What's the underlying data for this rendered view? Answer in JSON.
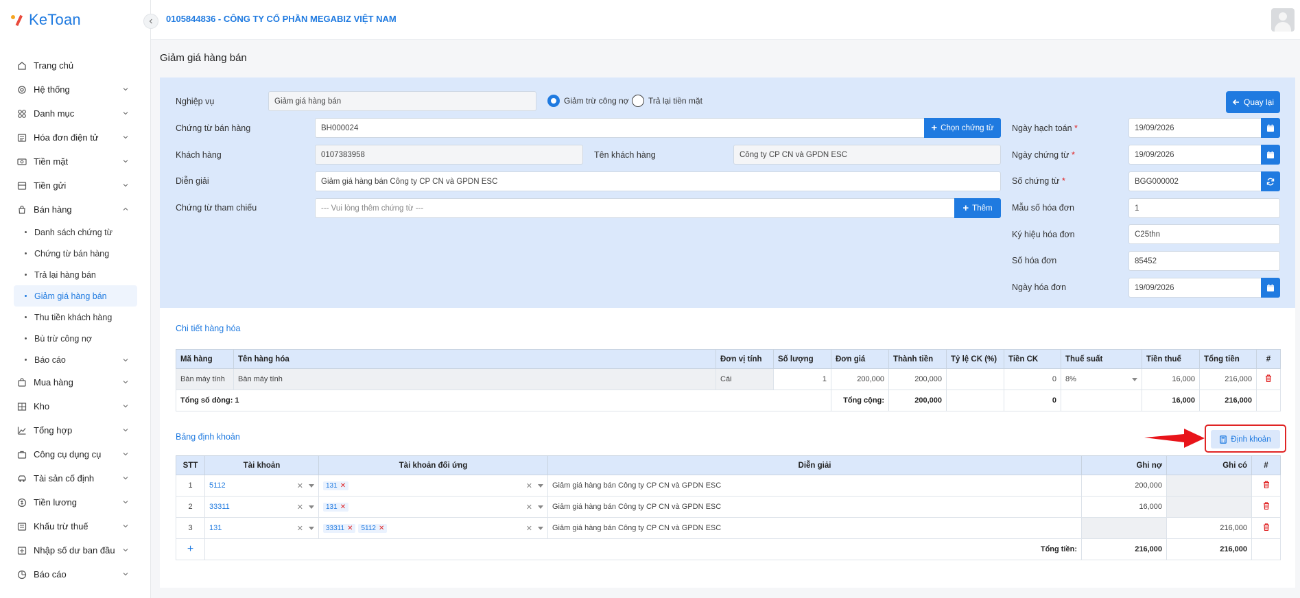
{
  "app": {
    "logo_text": "KeToan"
  },
  "header": {
    "company": "0105844836 - CÔNG TY CỔ PHẦN MEGABIZ VIỆT NAM"
  },
  "sidebar": {
    "items": [
      {
        "label": "Trang chủ",
        "icon": "home-icon"
      },
      {
        "label": "Hệ thống",
        "icon": "settings-icon"
      },
      {
        "label": "Danh mục",
        "icon": "grid-icon"
      },
      {
        "label": "Hóa đơn điện tử",
        "icon": "invoice-icon"
      },
      {
        "label": "Tiền mặt",
        "icon": "cash-icon"
      },
      {
        "label": "Tiền gửi",
        "icon": "bank-icon"
      },
      {
        "label": "Bán hàng",
        "icon": "cart-icon"
      }
    ],
    "sales_sub": [
      "Danh sách chứng từ",
      "Chứng từ bán hàng",
      "Trả lại hàng bán",
      "Giảm giá hàng bán",
      "Thu tiền khách hàng",
      "Bù trừ công nợ",
      "Báo cáo"
    ],
    "items_after": [
      {
        "label": "Mua hàng",
        "icon": "shopping-bag-icon"
      },
      {
        "label": "Kho",
        "icon": "warehouse-icon"
      },
      {
        "label": "Tổng hợp",
        "icon": "chart-icon"
      },
      {
        "label": "Công cụ dụng cụ",
        "icon": "tools-icon"
      },
      {
        "label": "Tài sản cố định",
        "icon": "car-icon"
      },
      {
        "label": "Tiền lương",
        "icon": "salary-icon"
      },
      {
        "label": "Khấu trừ thuế",
        "icon": "tax-icon"
      },
      {
        "label": "Nhập số dư ban đầu",
        "icon": "balance-icon"
      },
      {
        "label": "Báo cáo",
        "icon": "report-icon"
      }
    ]
  },
  "page": {
    "title": "Giảm giá hàng bán",
    "back_label": "Quay lại"
  },
  "form": {
    "nghiep_vu_label": "Nghiệp vụ",
    "nghiep_vu_value": "Giảm giá hàng bán",
    "radio_1": "Giảm trừ công nợ",
    "radio_2": "Trả lại tiền mặt",
    "chung_tu_ban_hang_label": "Chứng từ bán hàng",
    "chung_tu_ban_hang_value": "BH000024",
    "chon_chung_tu_label": "Chọn chứng từ",
    "khach_hang_label": "Khách hàng",
    "khach_hang_value": "0107383958",
    "ten_khach_hang_label": "Tên khách hàng",
    "ten_khach_hang_value": "Công ty CP CN và GPDN ESC",
    "dien_giai_label": "Diễn giải",
    "dien_giai_value": "Giảm giá hàng bán Công ty CP CN và GPDN ESC",
    "tham_chieu_label": "Chứng từ tham chiếu",
    "tham_chieu_placeholder": "--- Vui lòng thêm chứng từ ---",
    "them_label": "Thêm",
    "ngay_hach_toan_label": "Ngày hạch toán",
    "ngay_hach_toan_value": "19/09/2026",
    "ngay_chung_tu_label": "Ngày chứng từ",
    "ngay_chung_tu_value": "19/09/2026",
    "so_chung_tu_label": "Số chứng từ",
    "so_chung_tu_value": "BGG000002",
    "mau_so_label": "Mẫu số hóa đơn",
    "mau_so_value": "1",
    "ky_hieu_label": "Ký hiệu hóa đơn",
    "ky_hieu_value": "C25thn",
    "so_hoa_don_label": "Số hóa đơn",
    "so_hoa_don_value": "85452",
    "ngay_hoa_don_label": "Ngày hóa đơn",
    "ngay_hoa_don_value": "19/09/2026",
    "required_mark": "*"
  },
  "goods": {
    "title": "Chi tiết hàng hóa",
    "headers": [
      "Mã hàng",
      "Tên hàng hóa",
      "Đơn vị tính",
      "Số lượng",
      "Đơn giá",
      "Thành tiền",
      "Tỷ lệ CK (%)",
      "Tiền CK",
      "Thuế suất",
      "Tiền thuế",
      "Tổng tiền",
      "#"
    ],
    "row": {
      "ma_hang": "Bàn máy tính",
      "ten_hang": "Bàn máy tính",
      "dvt": "Cái",
      "so_luong": "1",
      "don_gia": "200,000",
      "thanh_tien": "200,000",
      "ty_le_ck": "",
      "tien_ck": "0",
      "thue_suat": "8%",
      "tien_thue": "16,000",
      "tong_tien": "216,000"
    },
    "total": {
      "rows_label": "Tổng số dòng: 1",
      "sum_label": "Tổng cộng:",
      "thanh_tien": "200,000",
      "tien_ck": "0",
      "tien_thue": "16,000",
      "tong_tien": "216,000"
    }
  },
  "ledger": {
    "title": "Bảng định khoản",
    "button_label": "Định khoản",
    "headers": [
      "STT",
      "Tài khoản",
      "Tài khoản đối ứng",
      "Diễn giải",
      "Ghi nợ",
      "Ghi có",
      "#"
    ],
    "rows": [
      {
        "stt": "1",
        "tk": "5112",
        "doi_ung": [
          "131"
        ],
        "dien_giai": "Giảm giá hàng bán Công ty CP CN và GPDN ESC",
        "no": "200,000",
        "co": ""
      },
      {
        "stt": "2",
        "tk": "33311",
        "doi_ung": [
          "131"
        ],
        "dien_giai": "Giảm giá hàng bán Công ty CP CN và GPDN ESC",
        "no": "16,000",
        "co": ""
      },
      {
        "stt": "3",
        "tk": "131",
        "doi_ung": [
          "33311",
          "5112"
        ],
        "dien_giai": "Giảm giá hàng bán Công ty CP CN và GPDN ESC",
        "no": "",
        "co": "216,000"
      }
    ],
    "add_symbol": "+",
    "total_label": "Tổng tiền:",
    "total_no": "216,000",
    "total_co": "216,000"
  },
  "colors": {
    "accent": "#1f7ae0",
    "panel": "#dbe8fb",
    "danger": "#e02424"
  }
}
